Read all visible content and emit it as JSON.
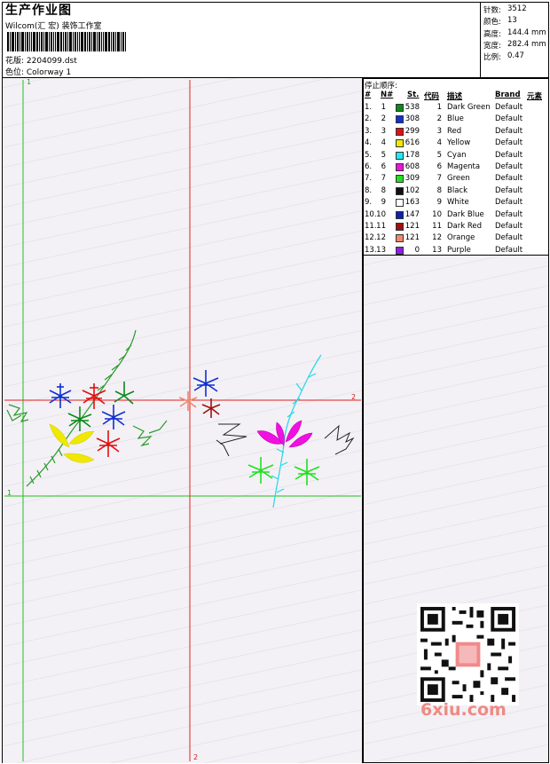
{
  "header": {
    "title": "生产作业图",
    "studio": "Wilcom(汇 宏) 装饰工作室",
    "design_label": "花版: 2204099.dst",
    "colorway_label": "色位: Colorway 1"
  },
  "stats": [
    {
      "label": "针数:",
      "value": "3512"
    },
    {
      "label": "颜色:",
      "value": "13"
    },
    {
      "label": "高度:",
      "value": "144.4 mm"
    },
    {
      "label": "宽度:",
      "value": "282.4 mm"
    },
    {
      "label": "比例:",
      "value": "0.47"
    }
  ],
  "stop_sequence": {
    "title": "停止顺序:",
    "headers": [
      "#",
      "N#",
      "St.",
      "代码",
      "描述",
      "Brand",
      "元素"
    ],
    "rows": [
      {
        "n": "1.",
        "num": "1",
        "st": "538",
        "code": "1",
        "desc": "Dark Green",
        "brand": "Default",
        "color": "#0a8a1a"
      },
      {
        "n": "2.",
        "num": "2",
        "st": "308",
        "code": "2",
        "desc": "Blue",
        "brand": "Default",
        "color": "#1030d0"
      },
      {
        "n": "3.",
        "num": "3",
        "st": "299",
        "code": "3",
        "desc": "Red",
        "brand": "Default",
        "color": "#e01010"
      },
      {
        "n": "4.",
        "num": "4",
        "st": "616",
        "code": "4",
        "desc": "Yellow",
        "brand": "Default",
        "color": "#f0e800"
      },
      {
        "n": "5.",
        "num": "5",
        "st": "178",
        "code": "5",
        "desc": "Cyan",
        "brand": "Default",
        "color": "#20e8f0"
      },
      {
        "n": "6.",
        "num": "6",
        "st": "608",
        "code": "6",
        "desc": "Magenta",
        "brand": "Default",
        "color": "#f010e0"
      },
      {
        "n": "7.",
        "num": "7",
        "st": "309",
        "code": "7",
        "desc": "Green",
        "brand": "Default",
        "color": "#20e020"
      },
      {
        "n": "8.",
        "num": "8",
        "st": "102",
        "code": "8",
        "desc": "Black",
        "brand": "Default",
        "color": "#101010"
      },
      {
        "n": "9.",
        "num": "9",
        "st": "163",
        "code": "9",
        "desc": "White",
        "brand": "Default",
        "color": "#ffffff"
      },
      {
        "n": "10.",
        "num": "10",
        "st": "147",
        "code": "10",
        "desc": "Dark Blue",
        "brand": "Default",
        "color": "#1020b0"
      },
      {
        "n": "11.",
        "num": "11",
        "st": "121",
        "code": "11",
        "desc": "Dark Red",
        "brand": "Default",
        "color": "#a01010"
      },
      {
        "n": "12.",
        "num": "12",
        "st": "121",
        "code": "12",
        "desc": "Orange",
        "brand": "Default",
        "color": "#f08870"
      },
      {
        "n": "13.",
        "num": "13",
        "st": "0",
        "code": "13",
        "desc": "Purple",
        "brand": "Default",
        "color": "#8a20e0"
      }
    ]
  },
  "canvas": {
    "marker_h1": "1",
    "marker_v1": "1",
    "marker_h2": "2",
    "marker_v2": "2"
  },
  "watermark": "6xiu.com"
}
